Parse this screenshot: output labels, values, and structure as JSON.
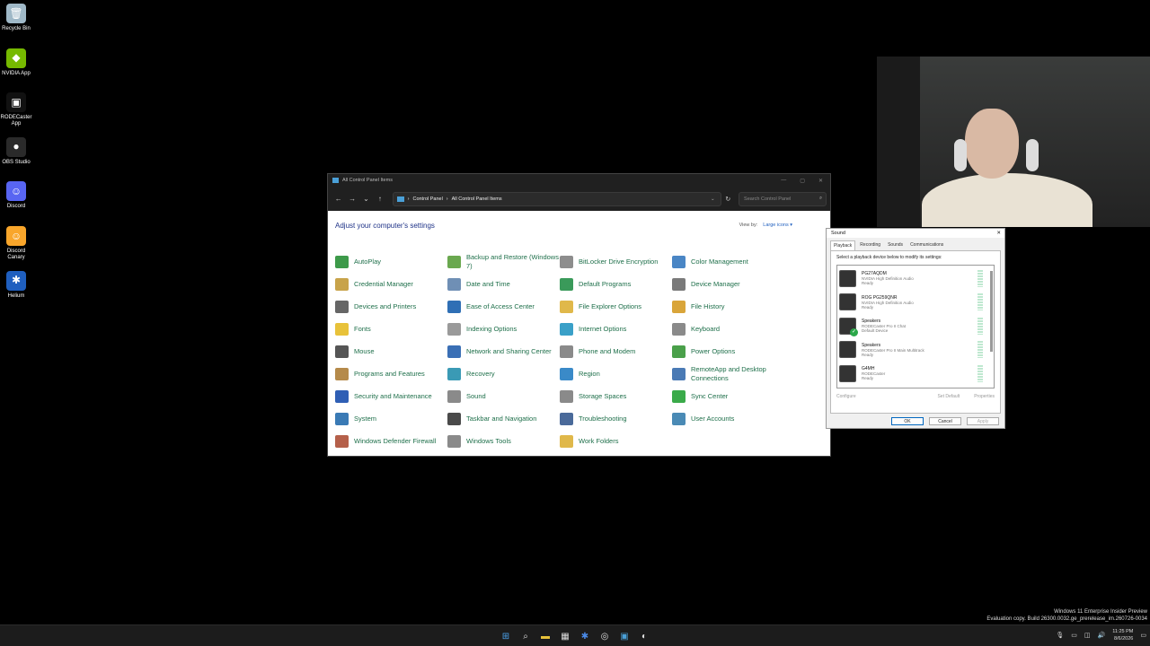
{
  "desktop_icons": [
    {
      "label": "Recycle Bin",
      "color": "#9fb8c7",
      "glyph": "🗑"
    },
    {
      "label": "NVIDIA App",
      "color": "#76b900",
      "glyph": "◆"
    },
    {
      "label": "RODECaster App",
      "color": "#111111",
      "glyph": "▣"
    },
    {
      "label": "OBS Studio",
      "color": "#2a2a2a",
      "glyph": "●"
    },
    {
      "label": "Discord",
      "color": "#5865f2",
      "glyph": "☺"
    },
    {
      "label": "Discord Canary",
      "color": "#f9a62b",
      "glyph": "☺"
    },
    {
      "label": "Helium",
      "color": "#1f5fbf",
      "glyph": "✱"
    }
  ],
  "control_panel": {
    "window_title": "All Control Panel Items",
    "breadcrumb": [
      "Control Panel",
      "All Control Panel Items"
    ],
    "search_placeholder": "Search Control Panel",
    "heading": "Adjust your computer's settings",
    "view_by_label": "View by:",
    "view_by_value": "Large icons ▾",
    "items": [
      {
        "label": "AutoPlay",
        "color": "#3d9a4a"
      },
      {
        "label": "Backup and Restore (Windows 7)",
        "color": "#6aa84f"
      },
      {
        "label": "BitLocker Drive Encryption",
        "color": "#8d8d8d"
      },
      {
        "label": "Color Management",
        "color": "#4a86c5"
      },
      {
        "label": "Credential Manager",
        "color": "#c8a34a"
      },
      {
        "label": "Date and Time",
        "color": "#6f8fb5"
      },
      {
        "label": "Default Programs",
        "color": "#3a9a5a"
      },
      {
        "label": "Device Manager",
        "color": "#7a7a7a"
      },
      {
        "label": "Devices and Printers",
        "color": "#666666"
      },
      {
        "label": "Ease of Access Center",
        "color": "#2f6fb5"
      },
      {
        "label": "File Explorer Options",
        "color": "#e0b84a"
      },
      {
        "label": "File History",
        "color": "#d9a53a"
      },
      {
        "label": "Fonts",
        "color": "#e8c23a"
      },
      {
        "label": "Indexing Options",
        "color": "#9a9a9a"
      },
      {
        "label": "Internet Options",
        "color": "#3aa0c8"
      },
      {
        "label": "Keyboard",
        "color": "#8a8a8a"
      },
      {
        "label": "Mouse",
        "color": "#555555"
      },
      {
        "label": "Network and Sharing Center",
        "color": "#3a6fb5"
      },
      {
        "label": "Phone and Modem",
        "color": "#8a8a8a"
      },
      {
        "label": "Power Options",
        "color": "#4aa04a"
      },
      {
        "label": "Programs and Features",
        "color": "#b58a4a"
      },
      {
        "label": "Recovery",
        "color": "#3a9ab5"
      },
      {
        "label": "Region",
        "color": "#3a8ac8"
      },
      {
        "label": "RemoteApp and Desktop Connections",
        "color": "#4a7ab5"
      },
      {
        "label": "Security and Maintenance",
        "color": "#2f5fb5"
      },
      {
        "label": "Sound",
        "color": "#8a8a8a"
      },
      {
        "label": "Storage Spaces",
        "color": "#8a8a8a"
      },
      {
        "label": "Sync Center",
        "color": "#3aaa4a"
      },
      {
        "label": "System",
        "color": "#3a7ab5"
      },
      {
        "label": "Taskbar and Navigation",
        "color": "#4a4a4a"
      },
      {
        "label": "Troubleshooting",
        "color": "#4a6a9a"
      },
      {
        "label": "User Accounts",
        "color": "#4a8ab5"
      },
      {
        "label": "Windows Defender Firewall",
        "color": "#b5604a"
      },
      {
        "label": "Windows Tools",
        "color": "#8a8a8a"
      },
      {
        "label": "Work Folders",
        "color": "#e0b84a"
      },
      {
        "label": "",
        "color": ""
      }
    ]
  },
  "sound_dialog": {
    "title": "Sound",
    "tabs": [
      "Playback",
      "Recording",
      "Sounds",
      "Communications"
    ],
    "instruction": "Select a playback device below to modify its settings:",
    "devices": [
      {
        "name": "PG27AQDM",
        "driver": "NVIDIA High Definition Audio",
        "status": "Ready",
        "default": false
      },
      {
        "name": "ROG PG259QNR",
        "driver": "NVIDIA High Definition Audio",
        "status": "Ready",
        "default": false
      },
      {
        "name": "Speakers",
        "driver": "RODECaster Pro II Chat",
        "status": "Default Device",
        "default": true
      },
      {
        "name": "Speakers",
        "driver": "RODECaster Pro II Main Multitrack",
        "status": "Ready",
        "default": false
      },
      {
        "name": "G4MH",
        "driver": "RODECaster",
        "status": "Ready",
        "default": false
      }
    ],
    "configure": "Configure",
    "set_default": "Set Default",
    "properties": "Properties",
    "ok": "OK",
    "cancel": "Cancel",
    "apply": "Apply"
  },
  "watermark": {
    "line1": "Windows 11 Enterprise Insider Preview",
    "line2": "Evaluation copy. Build 26300.0032.ge_prerelease_im.260726-0034"
  },
  "taskbar": {
    "time": "11:25 PM",
    "date": "8/6/2026"
  }
}
